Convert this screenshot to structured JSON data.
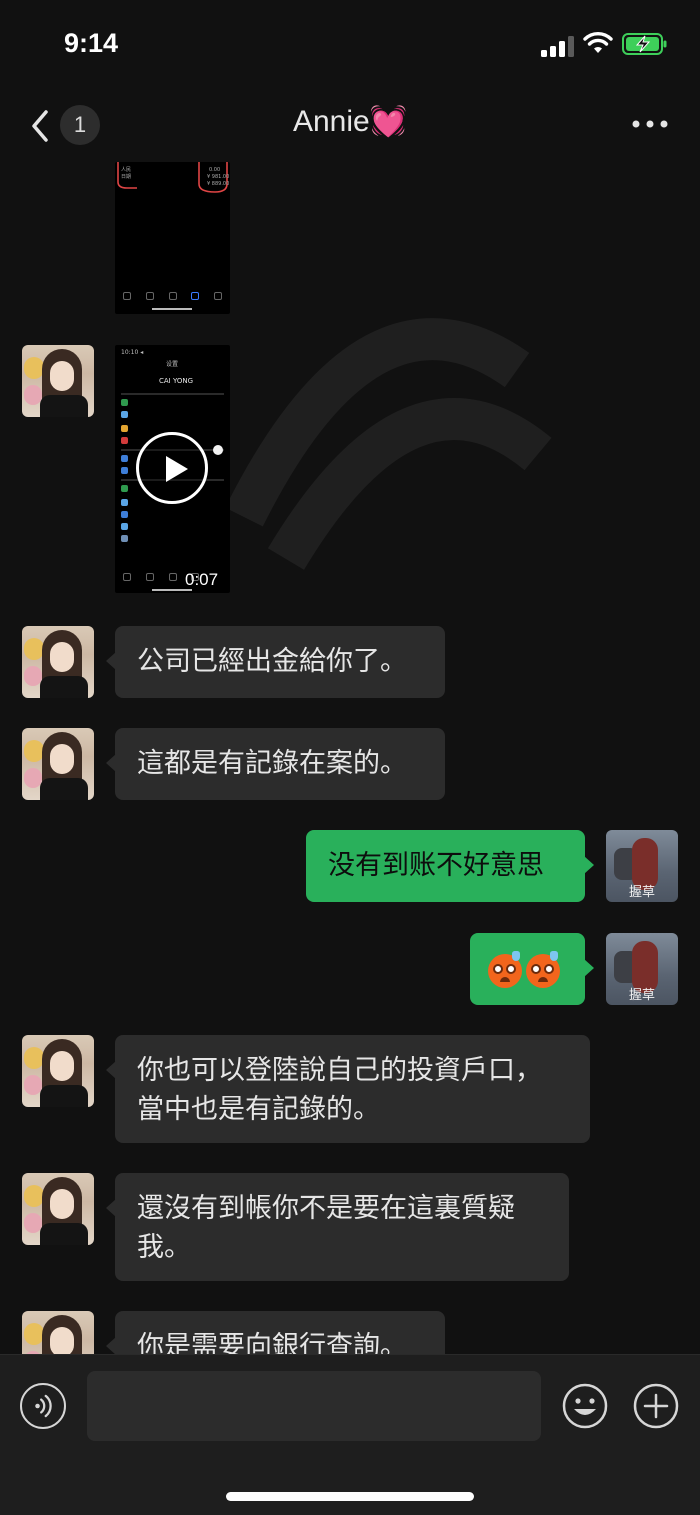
{
  "status_bar": {
    "time": "9:14"
  },
  "header": {
    "unread_count": "1",
    "title": "Annie💓"
  },
  "video": {
    "duration": "0:07"
  },
  "contacts": {
    "my_avatar_caption": "握草"
  },
  "messages": [
    {
      "from": "her",
      "text": "公司已經出金給你了。"
    },
    {
      "from": "her",
      "text": "這都是有記錄在案的。"
    },
    {
      "from": "me",
      "text": "没有到账不好意思"
    },
    {
      "from": "me",
      "emoji": [
        "sweating-face",
        "sweating-face"
      ]
    },
    {
      "from": "her",
      "text": "你也可以登陸說自己的投資戶口，\n當中也是有記錄的。"
    },
    {
      "from": "her",
      "text": "還沒有到帳你不是要在這裏質疑\n我。"
    },
    {
      "from": "her",
      "text": "你是需要向銀行查詢。"
    }
  ],
  "input_bar": {
    "draft_value": ""
  },
  "colors": {
    "background": "#111111",
    "incoming_bubble": "#2c2c2c",
    "outgoing_bubble": "#29b05b",
    "input_bar": "#1e1e1e"
  }
}
